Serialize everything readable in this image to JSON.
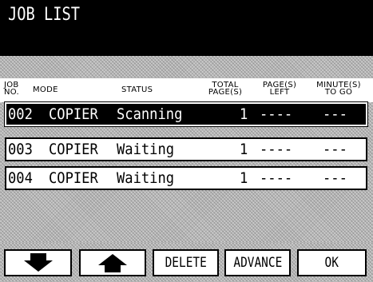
{
  "title": "JOB LIST",
  "headers": {
    "job_no": "JOB NO.",
    "mode": "MODE",
    "status": "STATUS",
    "total_pages": "TOTAL PAGE(S)",
    "pages_left": "PAGE(S) LEFT",
    "minutes_to_go": "MINUTE(S) TO GO"
  },
  "jobs": [
    {
      "no": "002",
      "mode": "COPIER",
      "status": "Scanning",
      "total": "1",
      "left": "----",
      "to_go": "---",
      "selected": true
    },
    {
      "no": "003",
      "mode": "COPIER",
      "status": "Waiting",
      "total": "1",
      "left": "----",
      "to_go": "---",
      "selected": false
    },
    {
      "no": "004",
      "mode": "COPIER",
      "status": "Waiting",
      "total": "1",
      "left": "----",
      "to_go": "---",
      "selected": false
    }
  ],
  "buttons": {
    "down_icon": "arrow-down-icon",
    "up_icon": "arrow-up-icon",
    "delete": "DELETE",
    "advance": "ADVANCE",
    "ok": "OK"
  }
}
